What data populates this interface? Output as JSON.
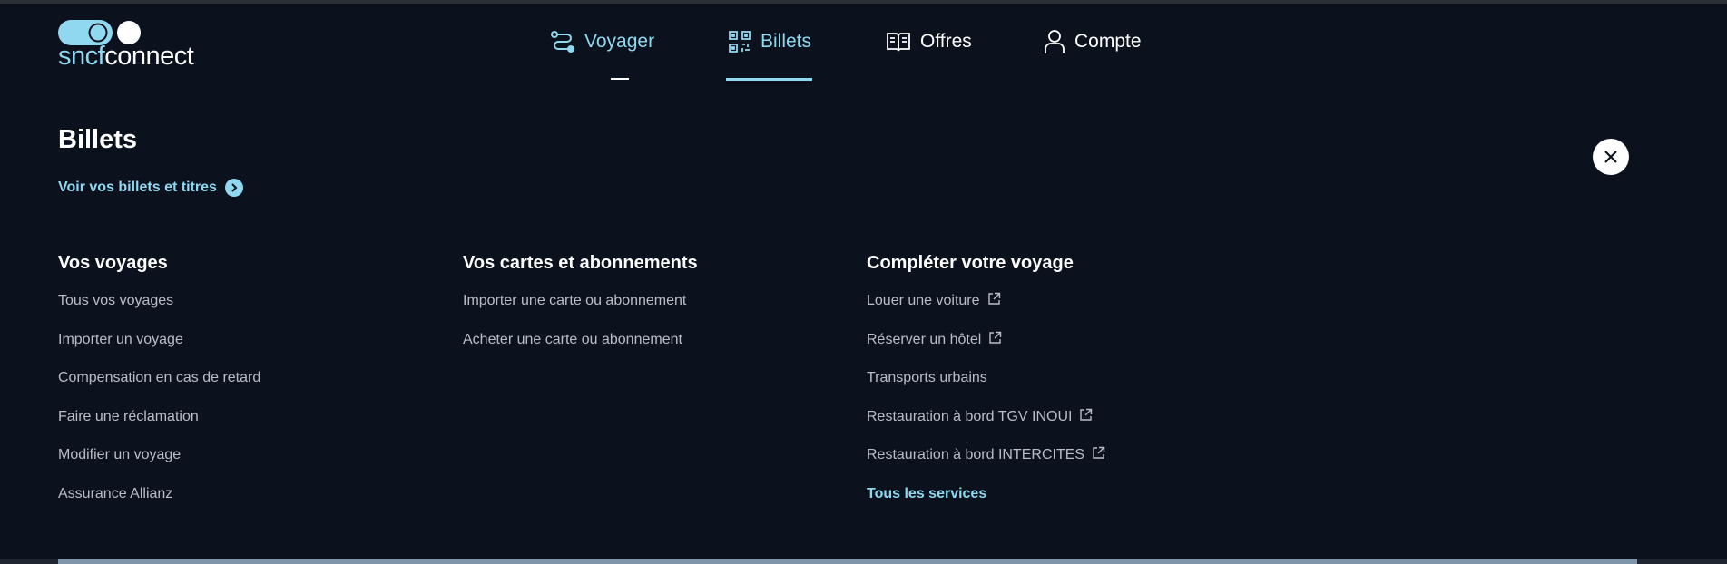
{
  "brand": {
    "part1": "sncf",
    "part2": "connect"
  },
  "nav": {
    "voyager": "Voyager",
    "billets": "Billets",
    "offres": "Offres",
    "compte": "Compte"
  },
  "section": {
    "title": "Billets",
    "link": "Voir vos billets et titres"
  },
  "columns": [
    {
      "title": "Vos voyages",
      "items": [
        "Tous vos voyages",
        "Importer un voyage",
        "Compensation en cas de retard",
        "Faire une réclamation",
        "Modifier un voyage",
        "Assurance Allianz"
      ]
    },
    {
      "title": "Vos cartes et abonnements",
      "items": [
        "Importer une carte ou abonnement",
        "Acheter une carte ou abonnement"
      ]
    },
    {
      "title": "Compléter votre voyage",
      "items": [
        "Louer une voiture",
        "Réserver un hôtel",
        "Transports urbains",
        "Restauration à bord TGV INOUI",
        "Restauration à bord INTERCITES",
        "Tous les services"
      ]
    }
  ],
  "colors": {
    "background": "#0b111d",
    "accent": "#8fd8f0",
    "text": "#ffffff",
    "muted": "#b9bec6"
  }
}
